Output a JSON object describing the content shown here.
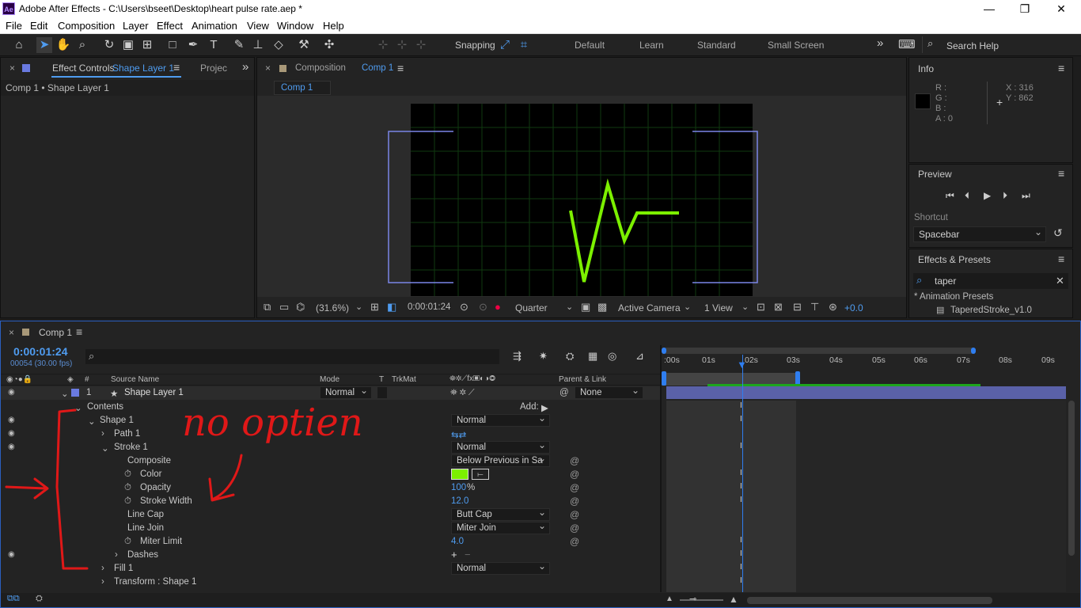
{
  "window": {
    "logo": "Ae",
    "title": "Adobe After Effects - C:\\Users\\bseet\\Desktop\\heart pulse rate.aep *",
    "minimize": "—",
    "restore": "❐",
    "close": "✕"
  },
  "menu": [
    "File",
    "Edit",
    "Composition",
    "Layer",
    "Effect",
    "Animation",
    "View",
    "Window",
    "Help"
  ],
  "toolbar": {
    "snapping": "Snapping",
    "workspaces": [
      "Default",
      "Learn",
      "Standard",
      "Small Screen"
    ],
    "more": "»",
    "search_placeholder": "Search Help"
  },
  "effect_controls": {
    "close": "×",
    "tab_label": "Effect Controls",
    "tab_layer": "Shape Layer 1",
    "menu": "≡",
    "project_tab": "Projec",
    "more": "»",
    "breadcrumb": "Comp 1 • Shape Layer 1"
  },
  "composition": {
    "close": "×",
    "tab_label": "Composition",
    "tab_name": "Comp 1",
    "menu": "≡",
    "subtab": "Comp 1",
    "footer": {
      "zoom": "(31.6%)",
      "time": "0:00:01:24",
      "resolution": "Quarter",
      "camera": "Active Camera",
      "views": "1 View",
      "exposure": "+0.0"
    }
  },
  "info": {
    "title": "Info",
    "menu": "≡",
    "r": "R :",
    "g": "G :",
    "b": "B :",
    "a": "A : 0",
    "x": "X : 316",
    "y": "Y : 862"
  },
  "preview": {
    "title": "Preview",
    "menu": "≡",
    "shortcut_label": "Shortcut",
    "shortcut_value": "Spacebar"
  },
  "effects_presets": {
    "title": "Effects & Presets",
    "menu": "≡",
    "search_value": "taper",
    "folder": "* Animation Presets",
    "item": "TaperedStroke_v1.0"
  },
  "timeline": {
    "close": "×",
    "tab": "Comp 1",
    "menu": "≡",
    "timecode": "0:00:01:24",
    "fps": "00054 (30.00 fps)",
    "headers": {
      "source": "Source Name",
      "mode": "Mode",
      "t": "T",
      "trkmat": "TrkMat",
      "parent": "Parent & Link"
    },
    "ruler": [
      ":00s",
      "01s",
      "02s",
      "03s",
      "04s",
      "05s",
      "06s",
      "07s",
      "08s",
      "09s"
    ],
    "layer": {
      "num": "1",
      "name": "Shape Layer 1",
      "mode": "Normal",
      "parent": "None"
    },
    "rows": [
      {
        "label": "Contents",
        "extra": "Add:"
      },
      {
        "label": "Shape 1",
        "mode": "Normal"
      },
      {
        "label": "Path 1"
      },
      {
        "label": "Stroke 1",
        "mode": "Normal"
      },
      {
        "label": "Composite",
        "mode": "Below Previous in Sa"
      },
      {
        "label": "Color"
      },
      {
        "label": "Opacity",
        "value": "100",
        "unit": "%"
      },
      {
        "label": "Stroke Width",
        "value": "12.0"
      },
      {
        "label": "Line Cap",
        "mode": "Butt Cap"
      },
      {
        "label": "Line Join",
        "mode": "Miter Join"
      },
      {
        "label": "Miter Limit",
        "value": "4.0"
      },
      {
        "label": "Dashes"
      },
      {
        "label": "Fill 1",
        "mode": "Normal"
      },
      {
        "label": "Transform : Shape 1"
      }
    ]
  },
  "annotation": {
    "text": "no optien"
  },
  "colors": {
    "stroke_color": "#7cf000",
    "accent": "#4f9cf0",
    "annotation": "#e01818",
    "layer_label": "#6a7ae0"
  }
}
